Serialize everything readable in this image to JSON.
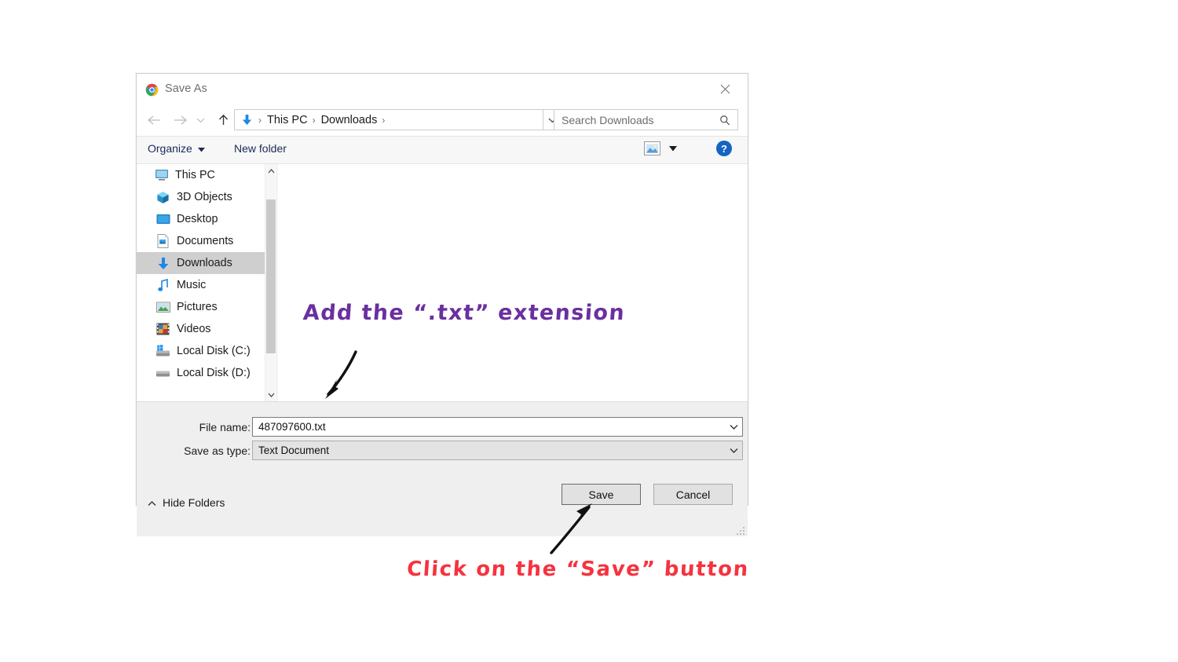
{
  "dialog": {
    "title": "Save As",
    "title_icon": "chrome-logo-icon",
    "close_icon": "close-icon"
  },
  "navbar": {
    "back_icon": "arrow-left-icon",
    "forward_icon": "arrow-right-icon",
    "history_icon": "chevron-down-icon",
    "up_icon": "arrow-up-icon",
    "breadcrumb_icon": "downloads-folder-icon",
    "breadcrumb": [
      "This PC",
      "Downloads"
    ],
    "separator": "›",
    "address_chevron_icon": "chevron-down-icon",
    "refresh_icon": "refresh-icon",
    "search_placeholder": "Search Downloads",
    "search_value": "",
    "search_icon": "search-icon"
  },
  "commandbar": {
    "organize_label": "Organize",
    "organize_caret_icon": "caret-down-icon",
    "new_folder_label": "New folder",
    "view_icon": "view-layout-icon",
    "view_caret_icon": "caret-down-icon",
    "help_icon": "help-icon",
    "help_label": "?"
  },
  "navpane": {
    "items": [
      {
        "label": "This PC",
        "icon": "monitor-icon",
        "selected": false,
        "level": 0
      },
      {
        "label": "3D Objects",
        "icon": "3d-objects-icon",
        "selected": false,
        "level": 1
      },
      {
        "label": "Desktop",
        "icon": "desktop-icon",
        "selected": false,
        "level": 1
      },
      {
        "label": "Documents",
        "icon": "documents-icon",
        "selected": false,
        "level": 1
      },
      {
        "label": "Downloads",
        "icon": "downloads-icon",
        "selected": true,
        "level": 1
      },
      {
        "label": "Music",
        "icon": "music-icon",
        "selected": false,
        "level": 1
      },
      {
        "label": "Pictures",
        "icon": "pictures-icon",
        "selected": false,
        "level": 1
      },
      {
        "label": "Videos",
        "icon": "videos-icon",
        "selected": false,
        "level": 1
      },
      {
        "label": "Local Disk (C:)",
        "icon": "system-drive-icon",
        "selected": false,
        "level": 1
      },
      {
        "label": "Local Disk (D:)",
        "icon": "drive-icon",
        "selected": false,
        "level": 1
      }
    ],
    "scroll_up_icon": "chevron-up-icon",
    "scroll_down_icon": "chevron-down-icon"
  },
  "form": {
    "filename_label": "File name:",
    "filename_value": "487097600.txt",
    "filename_chevron_icon": "chevron-down-icon",
    "savetype_label": "Save as type:",
    "savetype_value": "Text Document",
    "savetype_chevron_icon": "chevron-down-icon"
  },
  "footer": {
    "hide_folders_label": "Hide Folders",
    "hide_folders_icon": "chevron-up-icon",
    "save_label": "Save",
    "cancel_label": "Cancel",
    "resize_grip_icon": "resize-grip-icon"
  },
  "annotations": {
    "purple_text": "Add the “.txt” extension",
    "purple_color": "#6a2fa0",
    "red_text": "Click on the “Save” button",
    "red_color": "#f5333f",
    "arrow_to_filename_icon": "arrow-down-left-icon",
    "arrow_to_save_icon": "arrow-up-right-icon",
    "arrow_color": "#111111"
  }
}
